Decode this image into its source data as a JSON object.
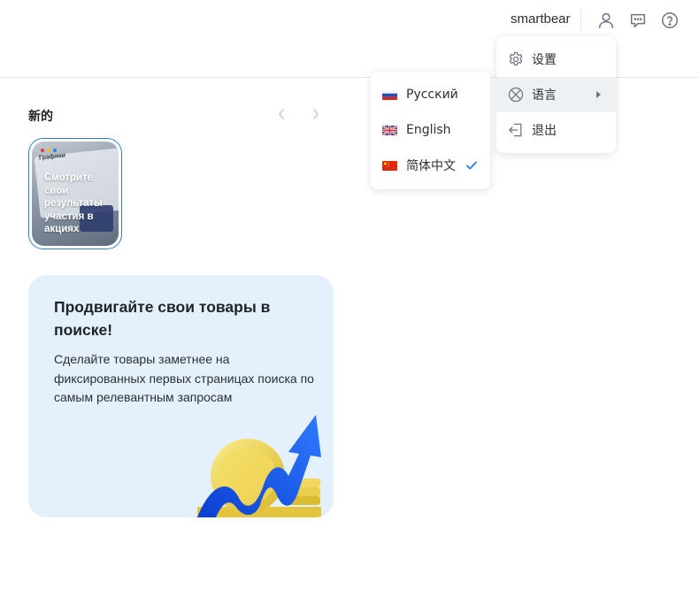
{
  "header": {
    "username": "smartbear",
    "icons": [
      "user-icon",
      "chat-icon",
      "help-icon"
    ]
  },
  "section": {
    "title": "新的",
    "prev_icon": "chevron-left-icon",
    "next_icon": "chevron-right-icon"
  },
  "story": {
    "mock_title": "Графики",
    "text": "Смотрите свои результаты участия в акциях"
  },
  "promo": {
    "title": "Продвигайте свои товары в поиске!",
    "text": "Сделайте товары заметнее на фиксированных первых страницах поиска по самым релевантным запросам"
  },
  "menu": {
    "items": [
      {
        "label": "设置",
        "icon": "gear-icon"
      },
      {
        "label": "语言",
        "icon": "language-icon",
        "active": true,
        "has_submenu": true
      },
      {
        "label": "退出",
        "icon": "logout-icon"
      }
    ]
  },
  "language_menu": {
    "items": [
      {
        "label": "Русский",
        "flag": "russia-flag-icon"
      },
      {
        "label": "English",
        "flag": "uk-flag-icon"
      },
      {
        "label": "简体中文",
        "flag": "china-flag-icon",
        "selected": true
      }
    ]
  },
  "colors": {
    "accent": "#2a80c9",
    "promo_bg": "#e4f1fc",
    "menu_active_bg": "#eef1f4",
    "check": "#1a73e8"
  }
}
